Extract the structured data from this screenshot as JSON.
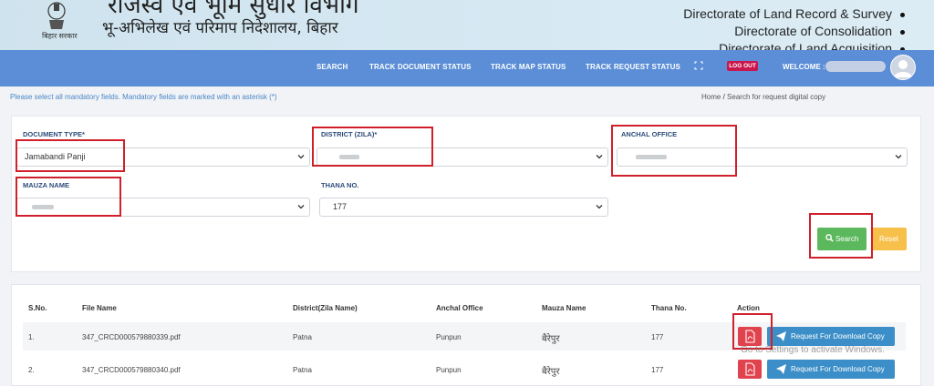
{
  "header": {
    "emblem_caption": "बिहार सरकार",
    "title_hindi": "राजस्व एवं भूमि सुधार विभाग",
    "subtitle_hindi": "भू-अभिलेख एवं परिमाप निदेशालय, बिहार",
    "directorates": [
      "Directorate of Land Record & Survey",
      "Directorate of Consolidation",
      "Directorate of Land Acquisition"
    ]
  },
  "nav": {
    "items": [
      "SEARCH",
      "TRACK DOCUMENT STATUS",
      "TRACK MAP STATUS",
      "TRACK REQUEST STATUS"
    ],
    "logout": "LOG OUT",
    "welcome": "WELCOME :"
  },
  "notice": "Please select all mandatory fields. Mandatory fields are marked with an asterisk (*)",
  "breadcrumb": {
    "home": "Home",
    "separator": "/",
    "current": "Search for request digital copy"
  },
  "form": {
    "document_type": {
      "label": "DOCUMENT TYPE*",
      "value": "Jamabandi Panji"
    },
    "district": {
      "label": "DISTRICT (ZILA)*",
      "value": ""
    },
    "anchal": {
      "label": "ANCHAL OFFICE",
      "value": ""
    },
    "mauza": {
      "label": "MAUZA NAME",
      "value": ""
    },
    "thana": {
      "label": "THANA NO.",
      "value": "177"
    },
    "search_label": "Search",
    "reset_label": "Reset"
  },
  "table": {
    "headers": [
      "S.No.",
      "File Name",
      "District(Zila Name)",
      "Anchal Office",
      "Mauza Name",
      "Thana No.",
      "Action"
    ],
    "rows": [
      {
        "sno": "1.",
        "file": "347_CRCD000579880339.pdf",
        "district": "Patna",
        "anchal": "Punpun",
        "mauza": "बैरेपुर",
        "thana": "177"
      },
      {
        "sno": "2.",
        "file": "347_CRCD000579880340.pdf",
        "district": "Patna",
        "anchal": "Punpun",
        "mauza": "बैरेपुर",
        "thana": "177"
      }
    ],
    "request_label": "Request For Download Copy"
  },
  "watermark": "Go to Settings to activate Windows.",
  "colors": {
    "navbar": "#5b8ed6",
    "logout": "#c9174d",
    "search": "#5cb85c",
    "reset": "#f7c04a",
    "pdf": "#e0434d",
    "request": "#3b8ec7",
    "highlight": "#d0202b"
  }
}
